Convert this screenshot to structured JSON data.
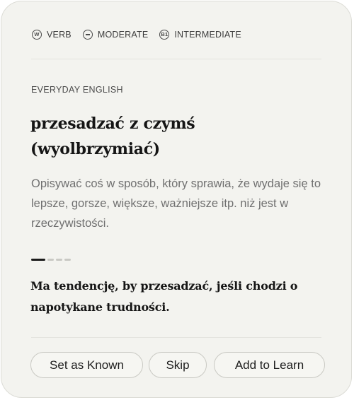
{
  "tags": [
    {
      "icon": "verb-icon",
      "icon_glyph": "W",
      "label": "VERB"
    },
    {
      "icon": "moderate-icon",
      "icon_glyph": "",
      "label": "MODERATE"
    },
    {
      "icon": "level-icon",
      "icon_glyph": "B1",
      "label": "INTERMEDIATE"
    }
  ],
  "category": "EVERYDAY ENGLISH",
  "term": "przesadzać z czymś (wyolbrzymiać)",
  "definition": "Opisywać coś w sposób, który sprawia, że wydaje się to lepsze, gorsze, większe, ważniejsze itp. niż jest w rzeczywistości.",
  "progress": {
    "current": 1,
    "total": 4
  },
  "example": "Ma tendencję, by przesadzać, jeśli chodzi o napotykane trudności.",
  "actions": {
    "known_label": "Set as Known",
    "skip_label": "Skip",
    "learn_label": "Add to Learn"
  }
}
